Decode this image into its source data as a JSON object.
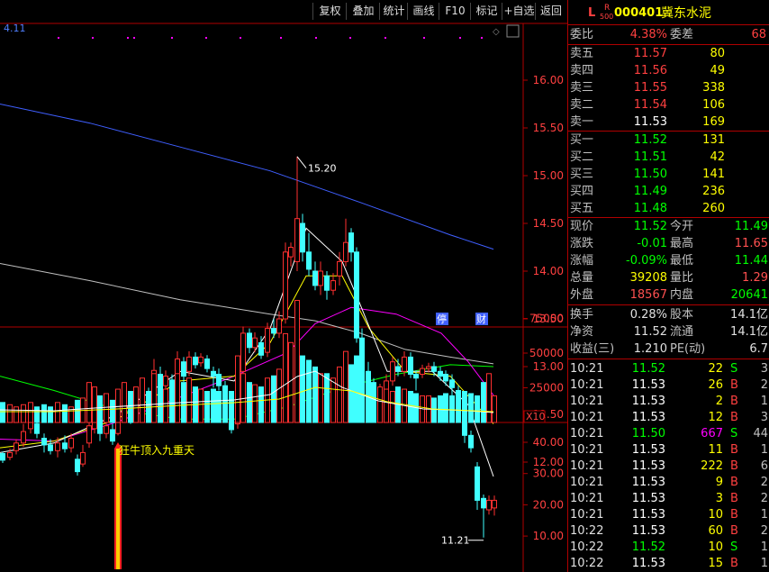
{
  "toolbar": {
    "buttons": [
      "复权",
      "叠加",
      "统计",
      "画线",
      "F10",
      "标记",
      "+自选",
      "返回"
    ],
    "indicator_value": "4.11"
  },
  "chart": {
    "y_ticks": [
      "16.00",
      "15.50",
      "15.00",
      "14.50",
      "14.00",
      "13.50",
      "13.00",
      "12.50",
      "12.00"
    ],
    "high_label": "15.20",
    "low_label": "11.21",
    "badge_suspend": "停",
    "badge_finance": "财",
    "ma_series": [
      {
        "name": "MA5",
        "color": "#ffffff"
      },
      {
        "name": "MA10",
        "color": "#ffff00"
      },
      {
        "name": "MA20",
        "color": "#ff00ff"
      },
      {
        "name": "MA60",
        "color": "#00ff00"
      },
      {
        "name": "MA120",
        "color": "#c0c0c0"
      },
      {
        "name": "MA250",
        "color": "#3f5fff"
      }
    ]
  },
  "volume": {
    "y_ticks": [
      "75000",
      "50000",
      "25000"
    ],
    "unit": "X10"
  },
  "signal": {
    "y_ticks": [
      "40.00",
      "30.00",
      "20.00",
      "10.00"
    ],
    "label": "狂牛顶入九重天"
  },
  "quote": {
    "market_tag": "L",
    "r_tag": "R",
    "r_sub": "500",
    "code": "000401",
    "name": "冀东水泥",
    "webi_label": "委比",
    "webi_value": "4.38%",
    "weicha_label": "委差",
    "weicha_value": "68",
    "asks": [
      {
        "label": "卖五",
        "price": "11.57",
        "vol": "80"
      },
      {
        "label": "卖四",
        "price": "11.56",
        "vol": "49"
      },
      {
        "label": "卖三",
        "price": "11.55",
        "vol": "338"
      },
      {
        "label": "卖二",
        "price": "11.54",
        "vol": "106"
      },
      {
        "label": "卖一",
        "price": "11.53",
        "vol": "169"
      }
    ],
    "bids": [
      {
        "label": "买一",
        "price": "11.52",
        "vol": "131"
      },
      {
        "label": "买二",
        "price": "11.51",
        "vol": "42"
      },
      {
        "label": "买三",
        "price": "11.50",
        "vol": "141"
      },
      {
        "label": "买四",
        "price": "11.49",
        "vol": "236"
      },
      {
        "label": "买五",
        "price": "11.48",
        "vol": "260"
      }
    ],
    "stats": [
      {
        "l1": "现价",
        "v1": "11.52",
        "c1": "#00ff00",
        "l2": "今开",
        "v2": "11.49",
        "c2": "#00ff00"
      },
      {
        "l1": "涨跌",
        "v1": "-0.01",
        "c1": "#00ff00",
        "l2": "最高",
        "v2": "11.65",
        "c2": "#ff5050"
      },
      {
        "l1": "涨幅",
        "v1": "-0.09%",
        "c1": "#00ff00",
        "l2": "最低",
        "v2": "11.44",
        "c2": "#00ff00"
      },
      {
        "l1": "总量",
        "v1": "39208",
        "c1": "#ffff00",
        "l2": "量比",
        "v2": "1.29",
        "c2": "#ff5050"
      },
      {
        "l1": "外盘",
        "v1": "18567",
        "c1": "#ff5050",
        "l2": "内盘",
        "v2": "20641",
        "c2": "#00ff00"
      }
    ],
    "stats2": [
      {
        "l1": "换手",
        "v1": "0.28%",
        "l2": "股本",
        "v2": "14.1亿"
      },
      {
        "l1": "净资",
        "v1": "11.52",
        "l2": "流通",
        "v2": "14.1亿"
      },
      {
        "l1": "收益(三)",
        "v1": "1.210",
        "l2": "PE(动)",
        "v2": "6.7"
      }
    ],
    "ticks": [
      {
        "time": "10:21",
        "price": "11.52",
        "pc": "#00ff00",
        "vol": "22",
        "vc": "#ffff00",
        "side": "S",
        "sc": "#00ff00",
        "n": "3"
      },
      {
        "time": "10:21",
        "price": "11.53",
        "pc": "#ffffff",
        "vol": "26",
        "vc": "#ffff00",
        "side": "B",
        "sc": "#ff4040",
        "n": "2"
      },
      {
        "time": "10:21",
        "price": "11.53",
        "pc": "#ffffff",
        "vol": "2",
        "vc": "#ffff00",
        "side": "B",
        "sc": "#ff4040",
        "n": "1"
      },
      {
        "time": "10:21",
        "price": "11.53",
        "pc": "#ffffff",
        "vol": "12",
        "vc": "#ffff00",
        "side": "B",
        "sc": "#ff4040",
        "n": "3"
      },
      {
        "time": "10:21",
        "price": "11.50",
        "pc": "#00ff00",
        "vol": "667",
        "vc": "#ff00ff",
        "side": "S",
        "sc": "#00ff00",
        "n": "44"
      },
      {
        "time": "10:21",
        "price": "11.53",
        "pc": "#ffffff",
        "vol": "11",
        "vc": "#ffff00",
        "side": "B",
        "sc": "#ff4040",
        "n": "1"
      },
      {
        "time": "10:21",
        "price": "11.53",
        "pc": "#ffffff",
        "vol": "222",
        "vc": "#ffff00",
        "side": "B",
        "sc": "#ff4040",
        "n": "6"
      },
      {
        "time": "10:21",
        "price": "11.53",
        "pc": "#ffffff",
        "vol": "9",
        "vc": "#ffff00",
        "side": "B",
        "sc": "#ff4040",
        "n": "2"
      },
      {
        "time": "10:21",
        "price": "11.53",
        "pc": "#ffffff",
        "vol": "3",
        "vc": "#ffff00",
        "side": "B",
        "sc": "#ff4040",
        "n": "2"
      },
      {
        "time": "10:21",
        "price": "11.53",
        "pc": "#ffffff",
        "vol": "10",
        "vc": "#ffff00",
        "side": "B",
        "sc": "#ff4040",
        "n": "1"
      },
      {
        "time": "10:22",
        "price": "11.53",
        "pc": "#ffffff",
        "vol": "60",
        "vc": "#ffff00",
        "side": "B",
        "sc": "#ff4040",
        "n": "2"
      },
      {
        "time": "10:22",
        "price": "11.52",
        "pc": "#00ff00",
        "vol": "10",
        "vc": "#ffff00",
        "side": "S",
        "sc": "#00ff00",
        "n": "1"
      },
      {
        "time": "10:22",
        "price": "11.53",
        "pc": "#ffffff",
        "vol": "15",
        "vc": "#ffff00",
        "side": "B",
        "sc": "#ff4040",
        "n": "1"
      }
    ]
  }
}
